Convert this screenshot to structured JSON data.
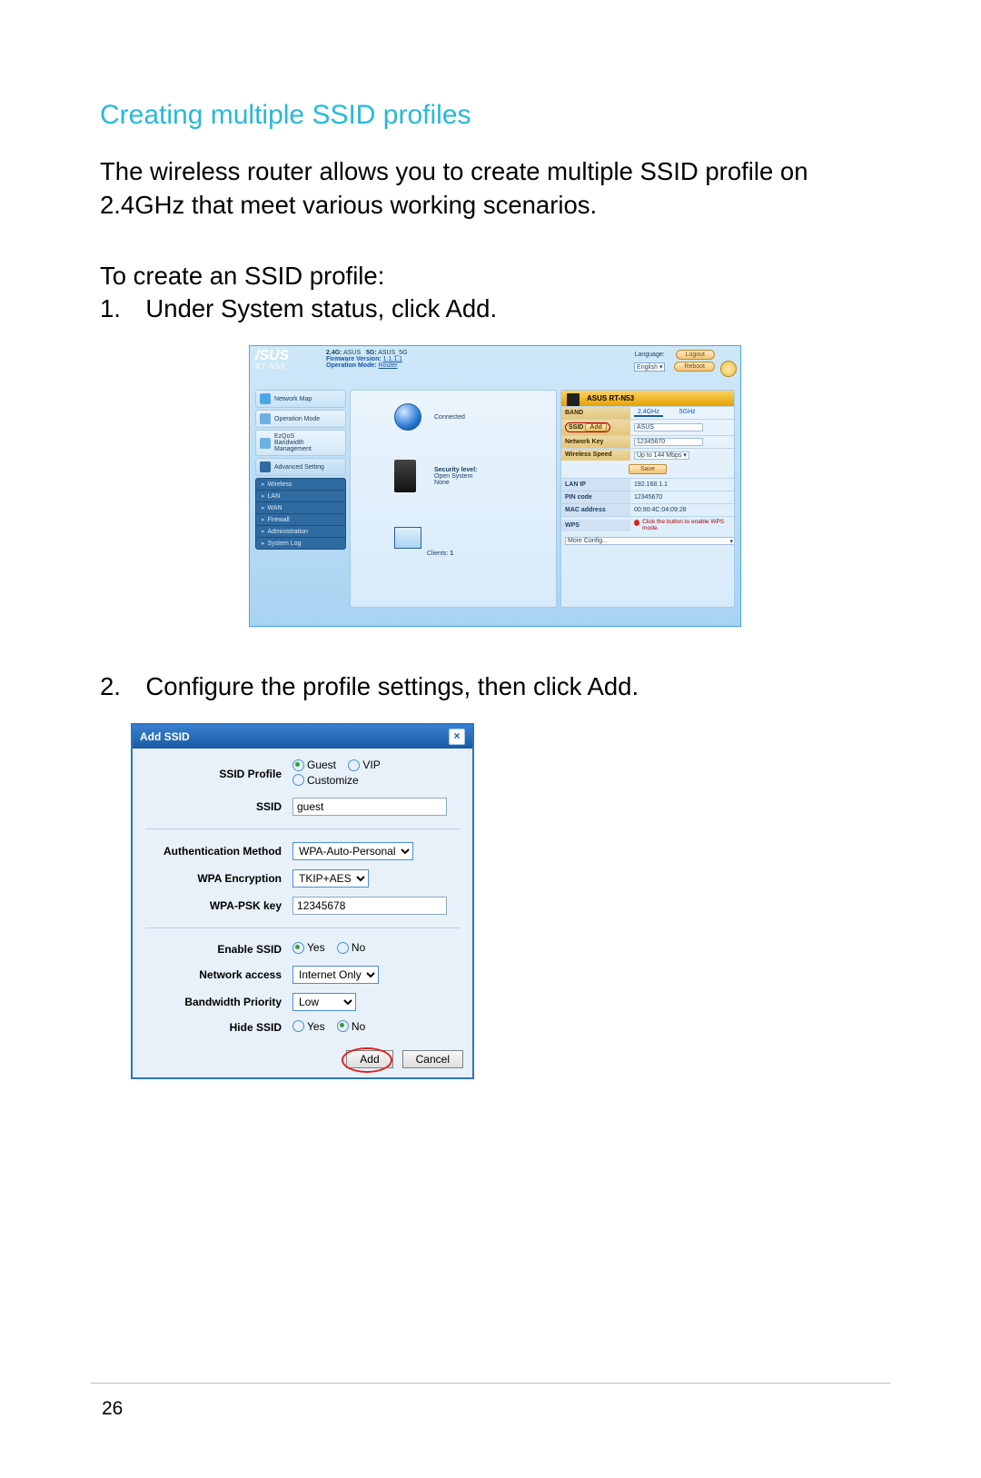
{
  "doc": {
    "section_title": "Creating multiple SSID profiles",
    "intro": "The wireless router allows you to create multiple SSID profile on 2.4GHz that meet various working scenarios.",
    "lead_in": "To create an SSID profile:",
    "step1": "1. Under System status, click Add.",
    "step2": "2. Configure the profile settings, then click Add.",
    "page_number": "26"
  },
  "router": {
    "brand": "/SUS",
    "model": "RT-N53",
    "band24_label": "2.4G:",
    "band24_ssid": "ASUS",
    "band5_label": "5G:",
    "band5_ssid": "ASUS_5G",
    "fw_label": "Firmware Version:",
    "fw_value": "1.1.1.1",
    "opmode_label": "Operation Mode:",
    "opmode_value": "Router",
    "lang_label": "Language:",
    "lang_value": "English",
    "logout": "Logout",
    "reboot": "Reboot",
    "sidebar": {
      "network_map": "Network Map",
      "operation_mode": "Operation Mode",
      "ezqos": "EzQoS\nBandwidth\nManagement",
      "advanced": "Advanced Setting",
      "menu": [
        "Wireless",
        "LAN",
        "WAN",
        "Firewall",
        "Administration",
        "System Log"
      ]
    },
    "center": {
      "connected": "Connected",
      "security_label": "Security level:",
      "security_value": "Open System\nNone",
      "clients_label": "Clients:",
      "clients_count": "1"
    },
    "status": {
      "title": "ASUS RT-N53",
      "rows": {
        "band_l": "BAND",
        "band_24": "2.4GHz",
        "band_5": "5GHz",
        "ssid_l": "SSID",
        "ssid_add": "Add",
        "ssid_val": "ASUS",
        "netkey_l": "Network Key",
        "netkey_val": "12345670",
        "wspeed_l": "Wireless Speed",
        "wspeed_val": "Up to 144 Mbps",
        "save": "Save",
        "lanip_l": "LAN IP",
        "lanip_val": "192.168.1.1",
        "pin_l": "PIN code",
        "pin_val": "12345670",
        "mac_l": "MAC address",
        "mac_val": "00:90:4C:04:09:28",
        "wps_l": "WPS",
        "wps_note": "Click the button to enable WPS mode.",
        "more": "More Config..."
      }
    }
  },
  "dialog": {
    "title": "Add SSID",
    "labels": {
      "profile": "SSID Profile",
      "ssid": "SSID",
      "auth": "Authentication Method",
      "enc": "WPA Encryption",
      "psk": "WPA-PSK key",
      "enable": "Enable SSID",
      "access": "Network access",
      "bw": "Bandwidth Priority",
      "hide": "Hide SSID"
    },
    "profile_options": {
      "guest": "Guest",
      "vip": "VIP",
      "custom": "Customize"
    },
    "ssid_value": "guest",
    "auth_value": "WPA-Auto-Personal",
    "enc_value": "TKIP+AES",
    "psk_value": "12345678",
    "yes": "Yes",
    "no": "No",
    "access_value": "Internet Only",
    "bw_value": "Low",
    "buttons": {
      "add": "Add",
      "cancel": "Cancel"
    }
  }
}
